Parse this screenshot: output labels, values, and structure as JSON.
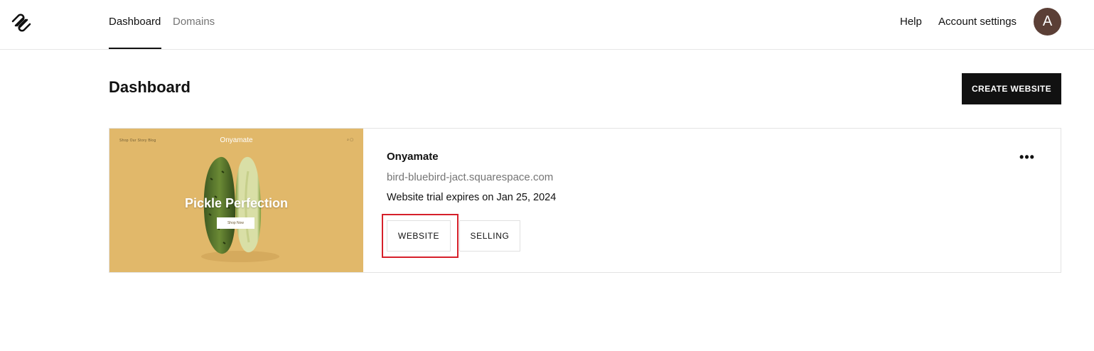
{
  "header": {
    "logo_icon": "squarespace-logo-icon",
    "tabs": [
      {
        "label": "Dashboard",
        "active": true
      },
      {
        "label": "Domains",
        "active": false
      }
    ],
    "help_label": "Help",
    "account_settings_label": "Account settings",
    "avatar_initial": "A",
    "avatar_color": "#5b3f36"
  },
  "page": {
    "title": "Dashboard",
    "create_button_label": "CREATE WEBSITE"
  },
  "site": {
    "thumbnail": {
      "brand": "Onyamate",
      "nav_text": "Shop  Our Story  Blog",
      "icons_text": "⌕ ▢",
      "headline": "Pickle Perfection",
      "cta": "Shop Now",
      "background_color": "#e1b86a"
    },
    "name": "Onyamate",
    "url": "bird-bluebird-jact.squarespace.com",
    "trial_text": "Website trial expires on Jan 25, 2024",
    "more_icon": "more-horizontal-icon",
    "more_glyph": "•••",
    "website_button_label": "WEBSITE",
    "selling_button_label": "SELLING",
    "highlight_color": "#d6202a"
  }
}
